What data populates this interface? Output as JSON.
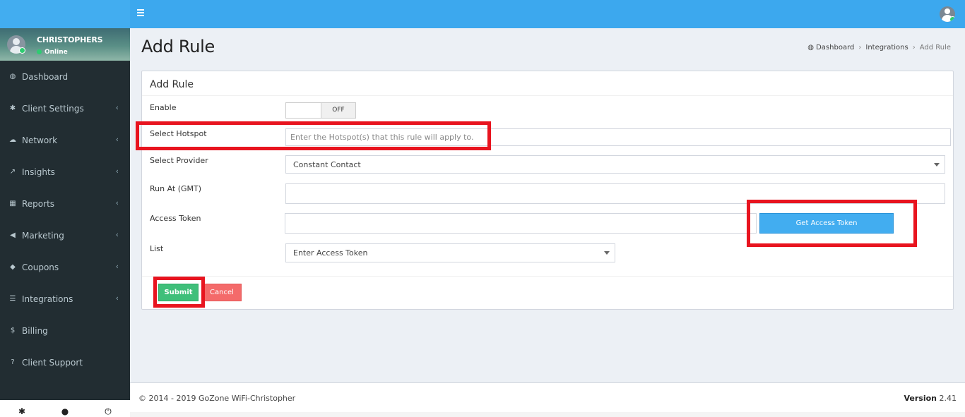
{
  "user": {
    "name": "CHRISTOPHERS",
    "status": "Online"
  },
  "sidebar": {
    "items": [
      {
        "label": "Dashboard",
        "icon": "dashboard-icon",
        "chevron": false
      },
      {
        "label": "Client Settings",
        "icon": "gear-icon",
        "chevron": true
      },
      {
        "label": "Network",
        "icon": "cloud-icon",
        "chevron": true
      },
      {
        "label": "Insights",
        "icon": "line-chart-icon",
        "chevron": true
      },
      {
        "label": "Reports",
        "icon": "table-icon",
        "chevron": true
      },
      {
        "label": "Marketing",
        "icon": "bullhorn-icon",
        "chevron": true
      },
      {
        "label": "Coupons",
        "icon": "tag-icon",
        "chevron": true
      },
      {
        "label": "Integrations",
        "icon": "server-icon",
        "chevron": true
      },
      {
        "label": "Billing",
        "icon": "dollar-icon",
        "chevron": false
      },
      {
        "label": "Client Support",
        "icon": "question-circle-icon",
        "chevron": false
      }
    ]
  },
  "page": {
    "title": "Add Rule"
  },
  "breadcrumb": {
    "dashboard": "Dashboard",
    "integrations": "Integrations",
    "current": "Add Rule"
  },
  "form": {
    "box_title": "Add Rule",
    "enable_label": "Enable",
    "toggle_state": "OFF",
    "hotspot_label": "Select Hotspot",
    "hotspot_placeholder": "Enter the Hotspot(s) that this rule will apply to.",
    "provider_label": "Select Provider",
    "provider_value": "Constant Contact",
    "run_at_label": "Run At (GMT)",
    "run_at_value": "",
    "token_label": "Access Token",
    "token_value": "",
    "token_button": "Get Access Token",
    "list_label": "List",
    "list_value": "Enter Access Token",
    "submit": "Submit",
    "cancel": "Cancel"
  },
  "footer": {
    "copyright": "© 2014 - 2019 GoZone WiFi-Christopher",
    "version_label": "Version",
    "version_value": "2.41"
  },
  "colors": {
    "topbar": "#3ca8ee",
    "sidebar": "#222d32",
    "highlight": "#e8141f",
    "submit": "#3fbf7a",
    "cancel": "#f46a6a",
    "token_button": "#42adf0"
  }
}
